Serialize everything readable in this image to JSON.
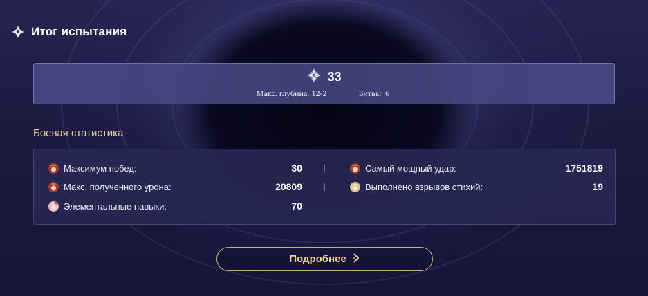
{
  "header": {
    "title": "Итог испытания",
    "icon": "abyss-star-icon"
  },
  "summary": {
    "stars": "33",
    "max_depth_label": "Макс. глубина: 12-2",
    "battles_label": "Битвы: 6"
  },
  "section": {
    "title": "Боевая статистика"
  },
  "stats": {
    "left": [
      {
        "label": "Максимум побед:",
        "value": "30",
        "icon": "character-avatar-icon"
      },
      {
        "label": "Макс. полученного урона:",
        "value": "20809",
        "icon": "character-avatar-icon"
      },
      {
        "label": "Элементальные навыки:",
        "value": "70",
        "icon": "character-avatar-icon"
      }
    ],
    "right": [
      {
        "label": "Самый мощный удар:",
        "value": "1751819",
        "icon": "character-avatar-icon"
      },
      {
        "label": "Выполнено взрывов стихий:",
        "value": "19",
        "icon": "character-avatar-icon"
      }
    ]
  },
  "button": {
    "label": "Подробнее",
    "icon": "chevron-right-icon"
  },
  "colors": {
    "accent_gold": "#e8cf9c",
    "background": "#1b1a40",
    "panel": "#484a84"
  }
}
